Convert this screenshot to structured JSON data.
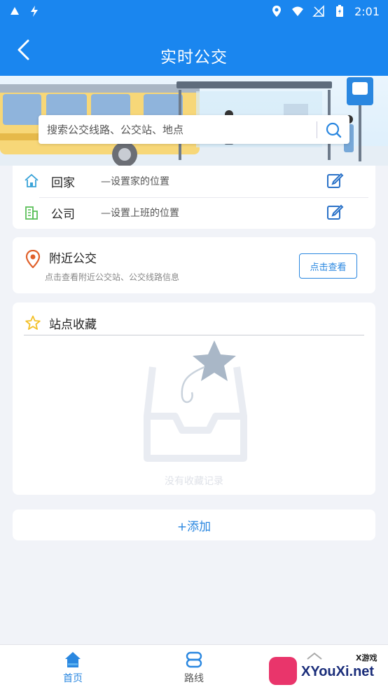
{
  "status_bar": {
    "time": "2:01"
  },
  "header": {
    "title": "实时公交"
  },
  "search": {
    "placeholder": "搜索公交线路、公交站、地点"
  },
  "addresses": [
    {
      "name": "回家",
      "desc": "—设置家的位置"
    },
    {
      "name": "公司",
      "desc": "—设置上班的位置"
    }
  ],
  "nearby": {
    "title": "附近公交",
    "subtitle": "点击查看附近公交站、公交线路信息",
    "button": "点击查看"
  },
  "favorites": {
    "title": "站点收藏",
    "empty_text": "没有收藏记录"
  },
  "add": {
    "label": "+添加"
  },
  "bottom_nav": [
    {
      "label": "首页",
      "icon": "home-icon",
      "active": true
    },
    {
      "label": "路线",
      "icon": "route-icon",
      "active": false
    }
  ],
  "watermark": {
    "text": "XYouXi.net",
    "small": "X游戏"
  },
  "colors": {
    "primary": "#1a86ef",
    "accent": "#2a87e0",
    "background": "#f1f3f8"
  }
}
